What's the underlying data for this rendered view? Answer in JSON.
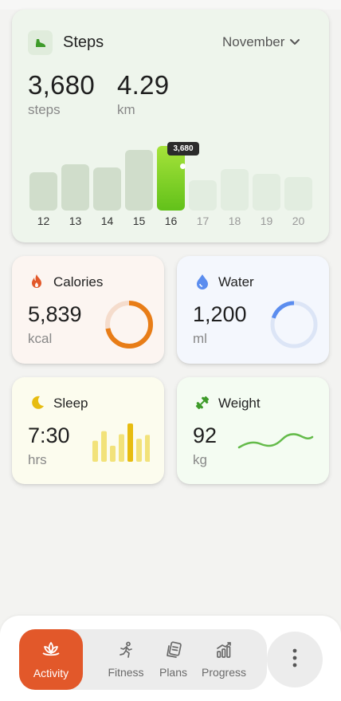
{
  "steps": {
    "title": "Steps",
    "month": "November",
    "count_value": "3,680",
    "count_unit": "steps",
    "distance_value": "4.29",
    "distance_unit": "km",
    "tooltip": "3,680"
  },
  "chart_data": {
    "type": "bar",
    "categories": [
      "12",
      "13",
      "14",
      "15",
      "16",
      "17",
      "18",
      "19",
      "20"
    ],
    "values": [
      2800,
      3400,
      3150,
      4400,
      4700,
      2200,
      3050,
      2700,
      2450
    ],
    "selected_index": 4,
    "ylim": [
      0,
      5000
    ],
    "title": "",
    "xlabel": "",
    "ylabel": ""
  },
  "calories": {
    "title": "Calories",
    "value": "5,839",
    "unit": "kcal",
    "progress": 0.72
  },
  "water": {
    "title": "Water",
    "value": "1,200",
    "unit": "ml",
    "progress": 0.2
  },
  "sleep": {
    "title": "Sleep",
    "value": "7:30",
    "unit": "hrs",
    "bars": [
      0.55,
      0.8,
      0.42,
      0.72,
      1.0,
      0.6,
      0.7
    ]
  },
  "weight": {
    "title": "Weight",
    "value": "92",
    "unit": "kg"
  },
  "nav": {
    "items": [
      {
        "label": "Activity",
        "icon": "lotus-icon"
      },
      {
        "label": "Fitness",
        "icon": "running-icon"
      },
      {
        "label": "Plans",
        "icon": "plans-icon"
      },
      {
        "label": "Progress",
        "icon": "progress-icon"
      }
    ]
  },
  "colors": {
    "accent": "#e2582a",
    "steps_active": "#62c11a",
    "calories": "#e87d17",
    "water": "#5b8def",
    "sleep": "#e7bc10",
    "weight": "#64bb4a"
  }
}
